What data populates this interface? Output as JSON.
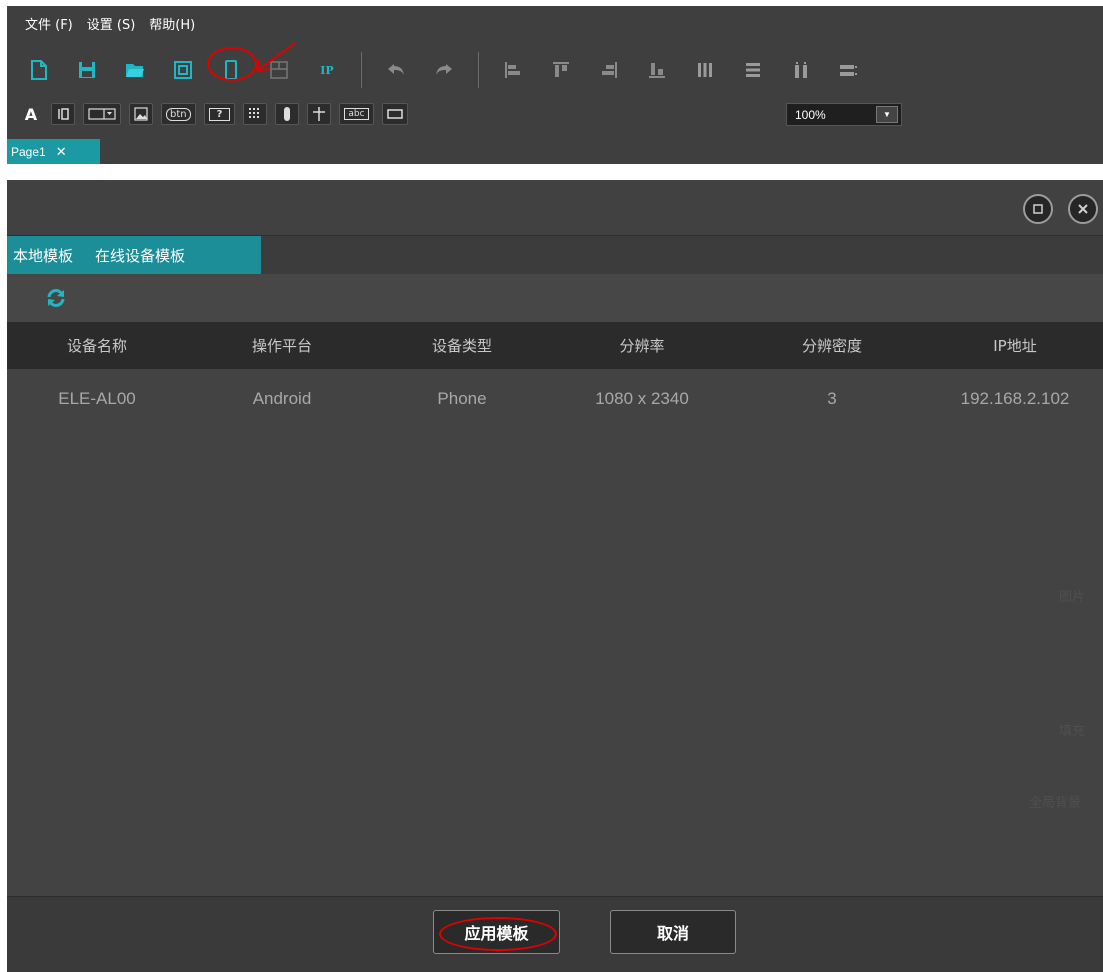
{
  "menubar": {
    "items": [
      "文件 (F)",
      "设置 (S)",
      "帮助(H)"
    ]
  },
  "toolbar1": {
    "icons": [
      "new-page-icon",
      "save-icon",
      "open-folder-icon",
      "template-window-icon",
      "phone-icon",
      "layout-icon",
      "ip-icon",
      "undo-icon",
      "redo-icon",
      "align-left-icon",
      "align-top-icon",
      "align-right-icon",
      "align-bottom-icon",
      "distribute-horizontal-icon",
      "distribute-vertical-icon",
      "same-width-icon",
      "same-height-icon"
    ],
    "ip_label": "IP"
  },
  "toolbar2": {
    "icons": [
      "text-icon",
      "text-field-icon",
      "combobox-icon",
      "image-icon",
      "button-widget-icon",
      "help-widget-icon",
      "grid-icon",
      "slider-icon",
      "cross-icon",
      "textbox-widget-icon",
      "rectangle-icon"
    ],
    "text_label": "A",
    "btn_label": "btn",
    "help_label": "?",
    "abc_label": "abc"
  },
  "zoom": {
    "value": "100%"
  },
  "page_tab": {
    "label": "Page1",
    "close": "✕"
  },
  "dialog": {
    "tabs": [
      "本地模板",
      "在线设备模板"
    ],
    "columns": [
      "设备名称",
      "操作平台",
      "设备类型",
      "分辨率",
      "分辨密度",
      "IP地址"
    ],
    "rows": [
      [
        "ELE-AL00",
        "Android",
        "Phone",
        "1080 x 2340",
        "3",
        "192.168.2.102"
      ]
    ],
    "ghost_labels": [
      "图片",
      "填充",
      "全局背景"
    ],
    "apply_label": "应用模板",
    "cancel_label": "取消"
  },
  "colors": {
    "accent": "#1b8e98",
    "toolbar_bg": "#3f3f3f",
    "annotation": "#e00000"
  }
}
